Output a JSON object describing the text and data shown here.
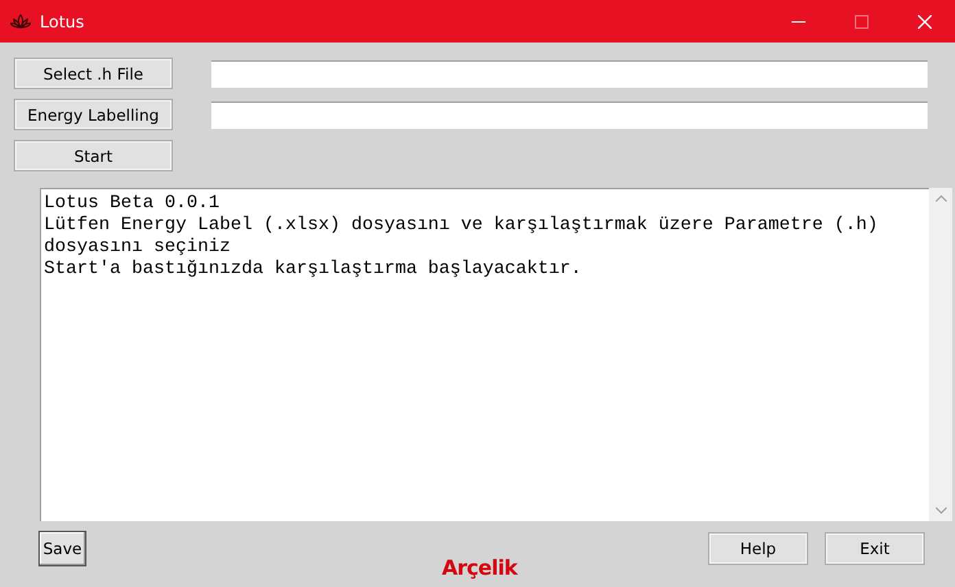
{
  "window": {
    "title": "Lotus",
    "maximize_disabled": true
  },
  "file_rows": [
    {
      "button": "Select .h File",
      "value": ""
    },
    {
      "button": "Energy Labelling",
      "value": ""
    }
  ],
  "start_button": "Start",
  "log_lines": [
    "Lotus Beta 0.0.1",
    "Lütfen Energy Label (.xlsx) dosyasını ve karşılaştırmak üzere Parametre (.h)",
    "dosyasını seçiniz",
    "Start'a bastığınızda karşılaştırma başlayacaktır."
  ],
  "save_button": "Save",
  "logo": "Arçelik",
  "buttons": [
    "Help",
    "Exit"
  ]
}
